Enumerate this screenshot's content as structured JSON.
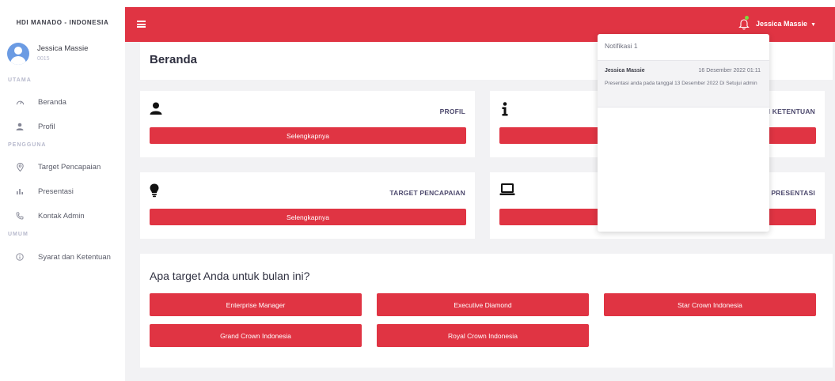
{
  "brand": "HDI MANADO - INDONESIA",
  "user": {
    "name": "Jessica Massie",
    "id": "0015"
  },
  "sidebar": {
    "sections": [
      {
        "label": "UTAMA"
      },
      {
        "label": "PENGGUNA"
      },
      {
        "label": "UMUM"
      }
    ],
    "items": [
      {
        "label": "Beranda",
        "icon": "dashboard-icon"
      },
      {
        "label": "Profil",
        "icon": "user-icon"
      },
      {
        "label": "Target Pencapaian",
        "icon": "target-icon"
      },
      {
        "label": "Presentasi",
        "icon": "chart-icon"
      },
      {
        "label": "Kontak Admin",
        "icon": "phone-icon"
      },
      {
        "label": "Syarat dan Ketentuan",
        "icon": "info-icon"
      }
    ]
  },
  "topbar": {
    "user_name": "Jessica Massie",
    "bell_dot_color": "#7cdb3c"
  },
  "page": {
    "title": "Beranda"
  },
  "cards": [
    {
      "title": "PROFIL",
      "button": "Selengkapnya",
      "icon": "user-icon"
    },
    {
      "title": "SYARAT DAN KETENTUAN",
      "visible_title": "N KETENTUAN",
      "button": "Selengkapnya",
      "icon": "info-icon"
    },
    {
      "title": "TARGET PENCAPAIAN",
      "button": "Selengkapnya",
      "icon": "lightbulb-icon"
    },
    {
      "title": "PRESENTASI",
      "button": "Selengkapnya",
      "icon": "laptop-icon"
    }
  ],
  "targets": {
    "question": "Apa target Anda untuk bulan ini?",
    "options": [
      "Enterprise Manager",
      "Executive Diamond",
      "Star Crown Indonesia",
      "Grand Crown Indonesia",
      "Royal Crown Indonesia"
    ]
  },
  "notifications": {
    "header": "Notifikasi 1",
    "items": [
      {
        "name": "Jessica Massie",
        "date": "16 Desember 2022 01:11",
        "message": "Presentasi anda pada tanggal 13 Desember 2022 Di Setujui admin"
      }
    ]
  },
  "colors": {
    "accent": "#e03443",
    "content_bg": "#f2f2f4"
  }
}
